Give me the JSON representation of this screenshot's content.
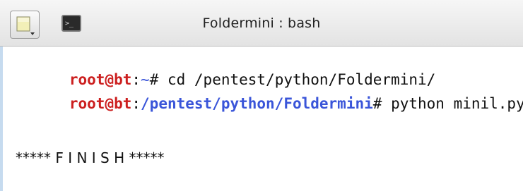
{
  "window": {
    "title": "Foldermini : bash"
  },
  "toolbar": {
    "menu_icon": "menu-icon",
    "terminal_icon": "terminal-icon"
  },
  "terminal": {
    "lines": [
      {
        "user": "root@bt",
        "sep": ":",
        "path": "~",
        "prompt": "# ",
        "command": "cd /pentest/python/Foldermini/"
      },
      {
        "user": "root@bt",
        "sep": ":",
        "path": "/pentest/python/Foldermini",
        "prompt": "# ",
        "command": "python minil.py"
      }
    ],
    "output": "***** F I N I S H *****"
  },
  "colors": {
    "user": "#cc1f1f",
    "path": "#3a55d9",
    "text": "#111111"
  }
}
